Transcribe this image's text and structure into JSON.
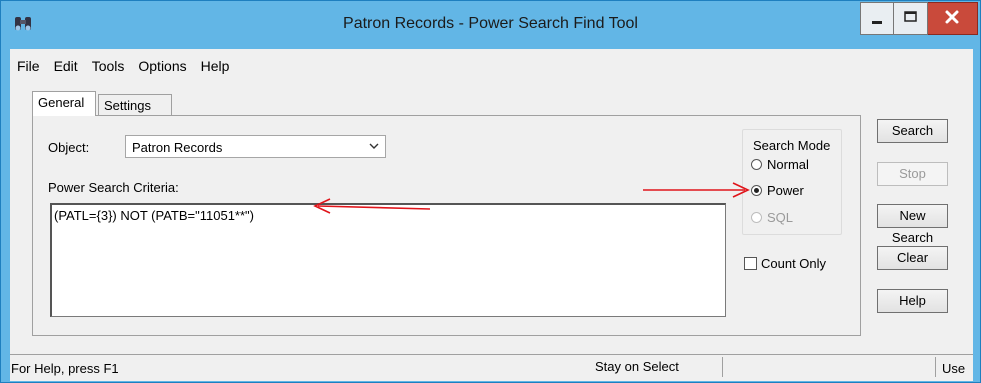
{
  "window": {
    "title": "Patron Records - Power Search Find Tool",
    "app_icon": "binoculars-icon",
    "controls": [
      "minimize-icon",
      "maximize-icon",
      "close-icon"
    ],
    "accent_color": "#62b6e6",
    "close_color": "#c94a3b"
  },
  "menu": {
    "items": [
      {
        "label": "File"
      },
      {
        "label": "Edit"
      },
      {
        "label": "Tools"
      },
      {
        "label": "Options"
      },
      {
        "label": "Help"
      }
    ]
  },
  "tabs": [
    {
      "label": "General",
      "active": true
    },
    {
      "label": "Settings",
      "active": false
    }
  ],
  "general": {
    "object_label": "Object:",
    "object_value": "Patron Records",
    "criteria_label": "Power Search Criteria:",
    "criteria_value": "(PATL={3}) NOT (PATB=\"11051**\")"
  },
  "search_mode": {
    "title": "Search Mode",
    "options": [
      {
        "label": "Normal",
        "checked": false,
        "disabled": false
      },
      {
        "label": "Power",
        "checked": true,
        "disabled": false
      },
      {
        "label": "SQL",
        "checked": false,
        "disabled": true
      }
    ]
  },
  "count_only": {
    "label": "Count Only",
    "checked": false
  },
  "buttons": {
    "search": "Search",
    "stop": "Stop",
    "new_search": "New Search",
    "clear": "Clear",
    "help": "Help"
  },
  "status": {
    "help_text": "For Help, press F1",
    "mode_text": "Stay on Select",
    "use_text": "Use"
  },
  "annotation_color": "#e0141a"
}
